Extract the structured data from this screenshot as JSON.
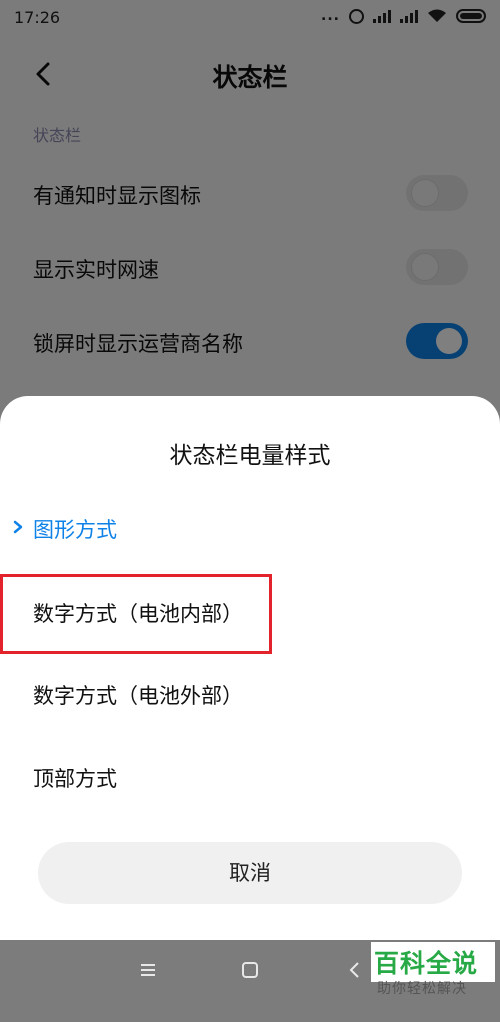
{
  "status_bar": {
    "time": "17:26",
    "more_dots": "...",
    "icons": [
      "alarm-icon",
      "hd-signal-icon",
      "signal-icon",
      "wifi-icon",
      "battery-icon"
    ]
  },
  "header": {
    "title": "状态栏",
    "back_icon": "chevron-left-icon"
  },
  "section": {
    "label": "状态栏"
  },
  "settings": [
    {
      "label": "有通知时显示图标",
      "enabled": false
    },
    {
      "label": "显示实时网速",
      "enabled": false
    },
    {
      "label": "锁屏时显示运营商名称",
      "enabled": true
    }
  ],
  "sheet": {
    "title": "状态栏电量样式",
    "options": [
      {
        "label": "图形方式",
        "selected": true
      },
      {
        "label": "数字方式（电池内部）",
        "selected": false
      },
      {
        "label": "数字方式（电池外部）",
        "selected": false
      },
      {
        "label": "顶部方式",
        "selected": false
      }
    ],
    "cancel_label": "取消"
  },
  "nav": {
    "icons": [
      "menu-icon",
      "home-icon",
      "back-icon"
    ]
  },
  "watermark": {
    "main": "百科全说",
    "sub": "助你轻松解决"
  },
  "colors": {
    "accent": "#0f82e8",
    "highlight_border": "#e3232c",
    "watermark_green": "#27a946"
  }
}
